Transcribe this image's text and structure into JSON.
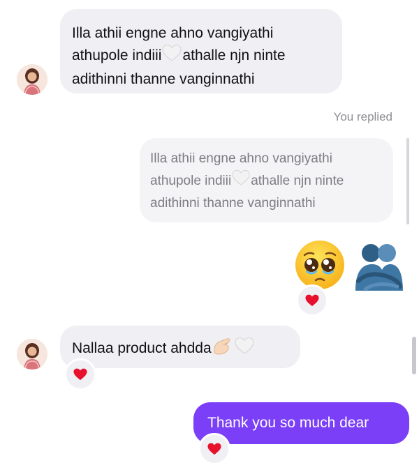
{
  "conversation": {
    "messages": [
      {
        "sender": "them",
        "lines": [
          "Illa athii engne ahno vangiyathi",
          "athupole indiii",
          "athalle njn ninte",
          "adithinni thanne vanginnathi"
        ],
        "inline_emoji": "white-heart"
      },
      {
        "sender": "me",
        "reply_label": "You replied",
        "quoted_lines": [
          "Illa athii engne ahno vangiyathi",
          "athupole indiii",
          "athalle njn ninte",
          "adithinni thanne vanginnathi"
        ],
        "emojis": [
          "pleading-face",
          "people-hugging"
        ],
        "reaction": "red-heart"
      },
      {
        "sender": "them",
        "text": "Nallaa product ahdda",
        "inline_emojis": [
          "pinching-hand",
          "white-heart"
        ],
        "reaction": "red-heart"
      },
      {
        "sender": "me",
        "text": "Thank you so much dear",
        "reaction": "red-heart"
      }
    ]
  },
  "colors": {
    "sent_bubble": "#7a3ff6",
    "received_bubble": "#efeff4",
    "reply_label": "#8e8e93",
    "heart": "#e8112d"
  }
}
